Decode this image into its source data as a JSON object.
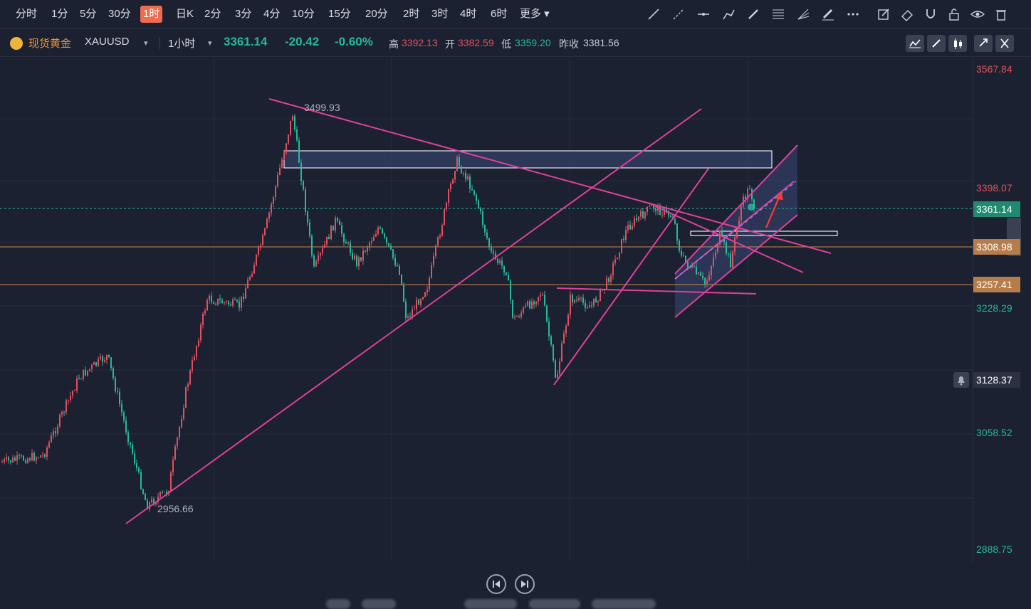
{
  "toolbar": {
    "timeframes": [
      "分时",
      "1分",
      "5分",
      "30分",
      "1时",
      "日K",
      "2分",
      "3分",
      "4分",
      "10分",
      "15分",
      "20分",
      "2时",
      "3时",
      "4时",
      "6时",
      "更多"
    ],
    "active": "1时",
    "tools": [
      "trend-line-icon",
      "ray-icon",
      "horizontal-line-icon",
      "path-icon",
      "brush-icon",
      "fibonacci-icon",
      "fan-icon",
      "highlighter-icon",
      "more-dots-icon",
      "note-edit-icon",
      "eraser-icon",
      "magnet-icon",
      "lock-icon",
      "eye-icon",
      "trash-icon"
    ]
  },
  "info": {
    "symbol_name": "现货黄金",
    "symbol_code": "XAUUSD",
    "interval": "1小时",
    "price": "3361.14",
    "change": "-20.42",
    "change_pct": "-0.60%",
    "high_label": "高",
    "high": "3392.13",
    "open_label": "开",
    "open": "3382.59",
    "low_label": "低",
    "low": "3359.20",
    "prev_label": "昨收",
    "prev": "3381.56"
  },
  "annotations": {
    "peak": "3499.93",
    "trough": "2956.66"
  },
  "axis": {
    "labels": [
      {
        "v": "3567.84",
        "c": "#e0505f"
      },
      {
        "v": "3398.07",
        "c": "#e0505f"
      },
      {
        "v": "3228.29",
        "c": "#26b99a"
      },
      {
        "v": "3058.52",
        "c": "#26b99a"
      },
      {
        "v": "2888.75",
        "c": "#26b99a"
      }
    ],
    "tags": [
      {
        "v": "3361.14",
        "bg": "#1f8a70"
      },
      {
        "v": "3308.98",
        "bg": "#b67d4a"
      },
      {
        "v": "3257.41",
        "bg": "#b67d4a"
      },
      {
        "v": "3128.37",
        "bg": "#2b3140"
      }
    ]
  },
  "colors": {
    "up": "#e0505f",
    "down": "#26b99a",
    "trendline": "#e0409a",
    "hline": "#c9874f",
    "bg": "#1b2130"
  }
}
